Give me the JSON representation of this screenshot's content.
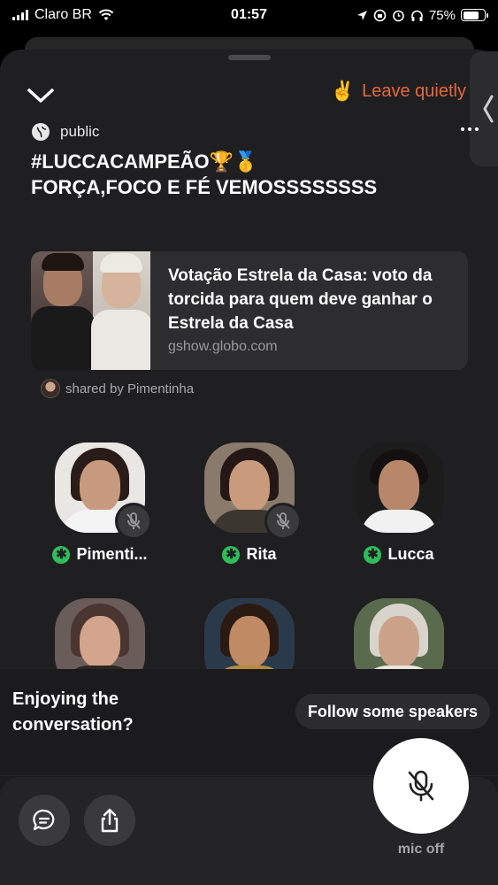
{
  "status_bar": {
    "carrier": "Claro BR",
    "time": "01:57",
    "battery": "75%",
    "battery_level": 0.75
  },
  "room": {
    "leave_emoji": "✌️",
    "leave_label": "Leave quietly",
    "visibility": "public",
    "title_line1": "#LUCCACAMPEÃO🏆🥇",
    "title_line2": "FORÇA,FOCO E FÉ VEMOSSSSSSSS"
  },
  "link_card": {
    "title": "Votação Estrela da Casa: voto da torcida para quem deve ganhar o Estrela da Casa",
    "domain": "gshow.globo.com",
    "shared_by": "shared by Pimentinha"
  },
  "speakers": [
    {
      "name": "Pimenti...",
      "muted": true,
      "badge": "✱"
    },
    {
      "name": "Rita",
      "muted": true,
      "badge": "✱"
    },
    {
      "name": "Lucca",
      "muted": false,
      "badge": "✱"
    },
    {
      "name": "",
      "muted": true,
      "badge": ""
    },
    {
      "name": "",
      "muted": true,
      "badge": ""
    },
    {
      "name": "",
      "muted": true,
      "badge": ""
    }
  ],
  "bottom": {
    "enjoy_line1": "Enjoying the",
    "enjoy_line2": "conversation?",
    "follow_label": "Follow some speakers",
    "mic_label": "mic off"
  },
  "colors": {
    "accent_leave": "#e8663d",
    "badge_green": "#2ebd59",
    "sheet_bg": "#1f1f21"
  },
  "icons": [
    "wifi-icon",
    "location-icon",
    "alarm-icon",
    "headphones-icon",
    "chevron-down-icon",
    "chevron-left-icon",
    "globe-icon",
    "more-icon",
    "mic-off-icon",
    "chat-icon",
    "share-icon"
  ]
}
